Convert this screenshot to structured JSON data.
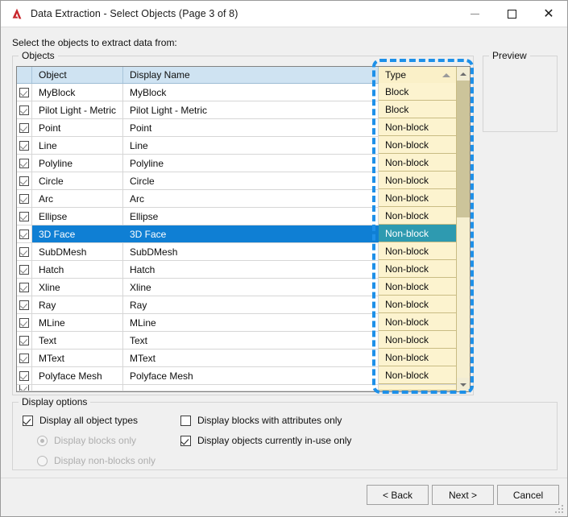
{
  "window": {
    "title": "Data Extraction - Select Objects (Page 3 of 8)",
    "icon": "autocad-a-icon",
    "minimize_label": "—",
    "maximize_label": "☐",
    "close_label": "✕"
  },
  "instruction": "Select the objects to extract data from:",
  "objects": {
    "group_label": "Objects",
    "columns": [
      "",
      "Object",
      "Display Name",
      "Type"
    ],
    "sort_column": "Type",
    "sort_direction": "ascending",
    "rows": [
      {
        "checked": true,
        "object": "MyBlock",
        "display_name": "MyBlock",
        "type": "Block",
        "selected": false
      },
      {
        "checked": true,
        "object": "Pilot Light - Metric",
        "display_name": "Pilot Light - Metric",
        "type": "Block",
        "selected": false
      },
      {
        "checked": true,
        "object": "Point",
        "display_name": "Point",
        "type": "Non-block",
        "selected": false
      },
      {
        "checked": true,
        "object": "Line",
        "display_name": "Line",
        "type": "Non-block",
        "selected": false
      },
      {
        "checked": true,
        "object": "Polyline",
        "display_name": "Polyline",
        "type": "Non-block",
        "selected": false
      },
      {
        "checked": true,
        "object": "Circle",
        "display_name": "Circle",
        "type": "Non-block",
        "selected": false
      },
      {
        "checked": true,
        "object": "Arc",
        "display_name": "Arc",
        "type": "Non-block",
        "selected": false
      },
      {
        "checked": true,
        "object": "Ellipse",
        "display_name": "Ellipse",
        "type": "Non-block",
        "selected": false
      },
      {
        "checked": true,
        "object": "3D Face",
        "display_name": "3D Face",
        "type": "Non-block",
        "selected": true
      },
      {
        "checked": true,
        "object": "SubDMesh",
        "display_name": "SubDMesh",
        "type": "Non-block",
        "selected": false
      },
      {
        "checked": true,
        "object": "Hatch",
        "display_name": "Hatch",
        "type": "Non-block",
        "selected": false
      },
      {
        "checked": true,
        "object": "Xline",
        "display_name": "Xline",
        "type": "Non-block",
        "selected": false
      },
      {
        "checked": true,
        "object": "Ray",
        "display_name": "Ray",
        "type": "Non-block",
        "selected": false
      },
      {
        "checked": true,
        "object": "MLine",
        "display_name": "MLine",
        "type": "Non-block",
        "selected": false
      },
      {
        "checked": true,
        "object": "Text",
        "display_name": "Text",
        "type": "Non-block",
        "selected": false
      },
      {
        "checked": true,
        "object": "MText",
        "display_name": "MText",
        "type": "Non-block",
        "selected": false
      },
      {
        "checked": true,
        "object": "Polyface Mesh",
        "display_name": "Polyface Mesh",
        "type": "Non-block",
        "selected": false
      }
    ],
    "scrollbar": {
      "up_arrow": "scroll-up-icon",
      "down_arrow": "scroll-down-icon"
    }
  },
  "preview": {
    "group_label": "Preview"
  },
  "display_options": {
    "group_label": "Display options",
    "items": [
      {
        "id": "display-all-object-types",
        "control": "checkbox",
        "label": "Display all object types",
        "checked": true,
        "disabled": false
      },
      {
        "id": "display-blocks-only",
        "control": "radio",
        "label": "Display blocks only",
        "checked": true,
        "disabled": true
      },
      {
        "id": "display-non-blocks-only",
        "control": "radio",
        "label": "Display non-blocks only",
        "checked": false,
        "disabled": true
      },
      {
        "id": "display-blocks-with-attributes-only",
        "control": "checkbox",
        "label": "Display blocks with attributes only",
        "checked": false,
        "disabled": false
      },
      {
        "id": "display-objects-currently-in-use-only",
        "control": "checkbox",
        "label": "Display objects currently in-use only",
        "checked": true,
        "disabled": false
      }
    ]
  },
  "buttons": {
    "back": "< Back",
    "next": "Next >",
    "cancel": "Cancel"
  },
  "annotation": {
    "shape": "dashed-rectangle",
    "color": "#1e90e8",
    "target": "Type column"
  },
  "colors": {
    "dialog_background": "#f0f0f0",
    "header_background": "#cfe3f2",
    "type_column_background": "#fcf3cf",
    "selection_blue": "#0f7fd4",
    "selection_type_cell": "#2e9ab0",
    "annotation_blue": "#1e90e8",
    "logo_red": "#c8262c"
  }
}
